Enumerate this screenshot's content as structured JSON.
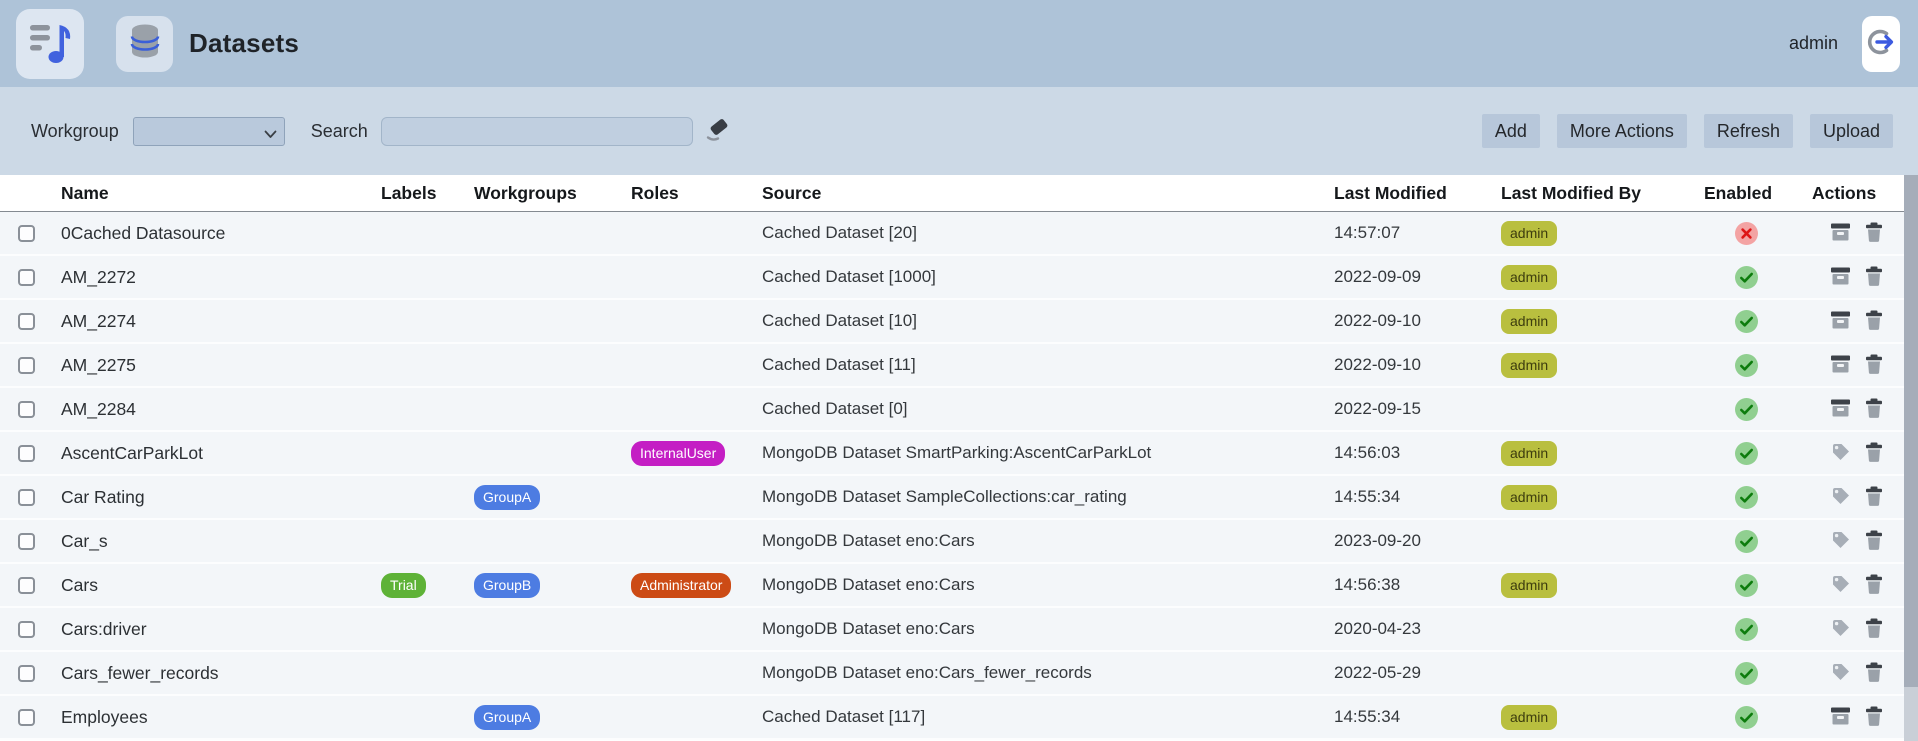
{
  "header": {
    "title": "Datasets",
    "user": "admin",
    "logo_icon": "playlist-music-icon",
    "page_icon": "database-icon",
    "logout_icon": "logout-icon"
  },
  "toolbar": {
    "workgroup_label": "Workgroup",
    "workgroup_value": "",
    "search_label": "Search",
    "search_value": "",
    "clear_icon": "eraser-icon",
    "buttons": [
      {
        "id": "add",
        "label": "Add"
      },
      {
        "id": "more-actions",
        "label": "More Actions"
      },
      {
        "id": "refresh",
        "label": "Refresh"
      },
      {
        "id": "upload",
        "label": "Upload"
      }
    ]
  },
  "table": {
    "columns": [
      "Name",
      "Labels",
      "Workgroups",
      "Roles",
      "Source",
      "Last Modified",
      "Last Modified By",
      "Enabled",
      "Actions"
    ],
    "rows": [
      {
        "name": "0Cached Datasource",
        "label": "",
        "workgroup": "",
        "role": "",
        "source": "Cached Dataset [20]",
        "last_modified": "14:57:07",
        "last_modified_by": "admin",
        "enabled": false,
        "actions": [
          "archive",
          "trash"
        ]
      },
      {
        "name": "AM_2272",
        "label": "",
        "workgroup": "",
        "role": "",
        "source": "Cached Dataset [1000]",
        "last_modified": "2022-09-09",
        "last_modified_by": "admin",
        "enabled": true,
        "actions": [
          "archive",
          "trash"
        ]
      },
      {
        "name": "AM_2274",
        "label": "",
        "workgroup": "",
        "role": "",
        "source": "Cached Dataset [10]",
        "last_modified": "2022-09-10",
        "last_modified_by": "admin",
        "enabled": true,
        "actions": [
          "archive",
          "trash"
        ]
      },
      {
        "name": "AM_2275",
        "label": "",
        "workgroup": "",
        "role": "",
        "source": "Cached Dataset [11]",
        "last_modified": "2022-09-10",
        "last_modified_by": "admin",
        "enabled": true,
        "actions": [
          "archive",
          "trash"
        ]
      },
      {
        "name": "AM_2284",
        "label": "",
        "workgroup": "",
        "role": "",
        "source": "Cached Dataset [0]",
        "last_modified": "2022-09-15",
        "last_modified_by": "",
        "enabled": true,
        "actions": [
          "archive",
          "trash"
        ]
      },
      {
        "name": "AscentCarParkLot",
        "label": "",
        "workgroup": "",
        "role": "InternalUser",
        "source": "MongoDB Dataset SmartParking:AscentCarParkLot",
        "last_modified": "14:56:03",
        "last_modified_by": "admin",
        "enabled": true,
        "actions": [
          "tag",
          "trash"
        ]
      },
      {
        "name": "Car Rating",
        "label": "",
        "workgroup": "GroupA",
        "role": "",
        "source": "MongoDB Dataset SampleCollections:car_rating",
        "last_modified": "14:55:34",
        "last_modified_by": "admin",
        "enabled": true,
        "actions": [
          "tag",
          "trash"
        ]
      },
      {
        "name": "Car_s",
        "label": "",
        "workgroup": "",
        "role": "",
        "source": "MongoDB Dataset eno:Cars",
        "last_modified": "2023-09-20",
        "last_modified_by": "",
        "enabled": true,
        "actions": [
          "tag",
          "trash"
        ]
      },
      {
        "name": "Cars",
        "label": "Trial",
        "workgroup": "GroupB",
        "role": "Administrator",
        "source": "MongoDB Dataset eno:Cars",
        "last_modified": "14:56:38",
        "last_modified_by": "admin",
        "enabled": true,
        "actions": [
          "tag",
          "trash"
        ]
      },
      {
        "name": "Cars:driver",
        "label": "",
        "workgroup": "",
        "role": "",
        "source": "MongoDB Dataset eno:Cars",
        "last_modified": "2020-04-23",
        "last_modified_by": "",
        "enabled": true,
        "actions": [
          "tag",
          "trash"
        ]
      },
      {
        "name": "Cars_fewer_records",
        "label": "",
        "workgroup": "",
        "role": "",
        "source": "MongoDB Dataset eno:Cars_fewer_records",
        "last_modified": "2022-05-29",
        "last_modified_by": "",
        "enabled": true,
        "actions": [
          "tag",
          "trash"
        ]
      },
      {
        "name": "Employees",
        "label": "",
        "workgroup": "GroupA",
        "role": "",
        "source": "Cached Dataset [117]",
        "last_modified": "14:55:34",
        "last_modified_by": "admin",
        "enabled": true,
        "actions": [
          "archive",
          "trash"
        ]
      }
    ]
  },
  "badge_colors": {
    "Trial": {
      "bg": "#5eb237",
      "fg": "#ffffff"
    },
    "GroupA": {
      "bg": "#4d7ce2",
      "fg": "#ffffff"
    },
    "GroupB": {
      "bg": "#4d7ce2",
      "fg": "#ffffff"
    },
    "InternalUser": {
      "bg": "#c41ec4",
      "fg": "#ffffff"
    },
    "Administrator": {
      "bg": "#cc4b15",
      "fg": "#ffffff"
    },
    "admin": {
      "bg": "#b9bf3f",
      "fg": "#3d3d0e"
    }
  },
  "status_colors": {
    "enabled_bg": "#90cf90",
    "enabled_fg": "#0d7c0d",
    "disabled_bg": "#f3a3a3",
    "disabled_fg": "#dd1717"
  },
  "theme": {
    "topbar_bg": "#aec3d8",
    "toolbar_bg": "#ccd9e6",
    "button_bg": "#b7c7da",
    "row_bg": "#f3f6f9",
    "accent_blue": "#4162de"
  }
}
